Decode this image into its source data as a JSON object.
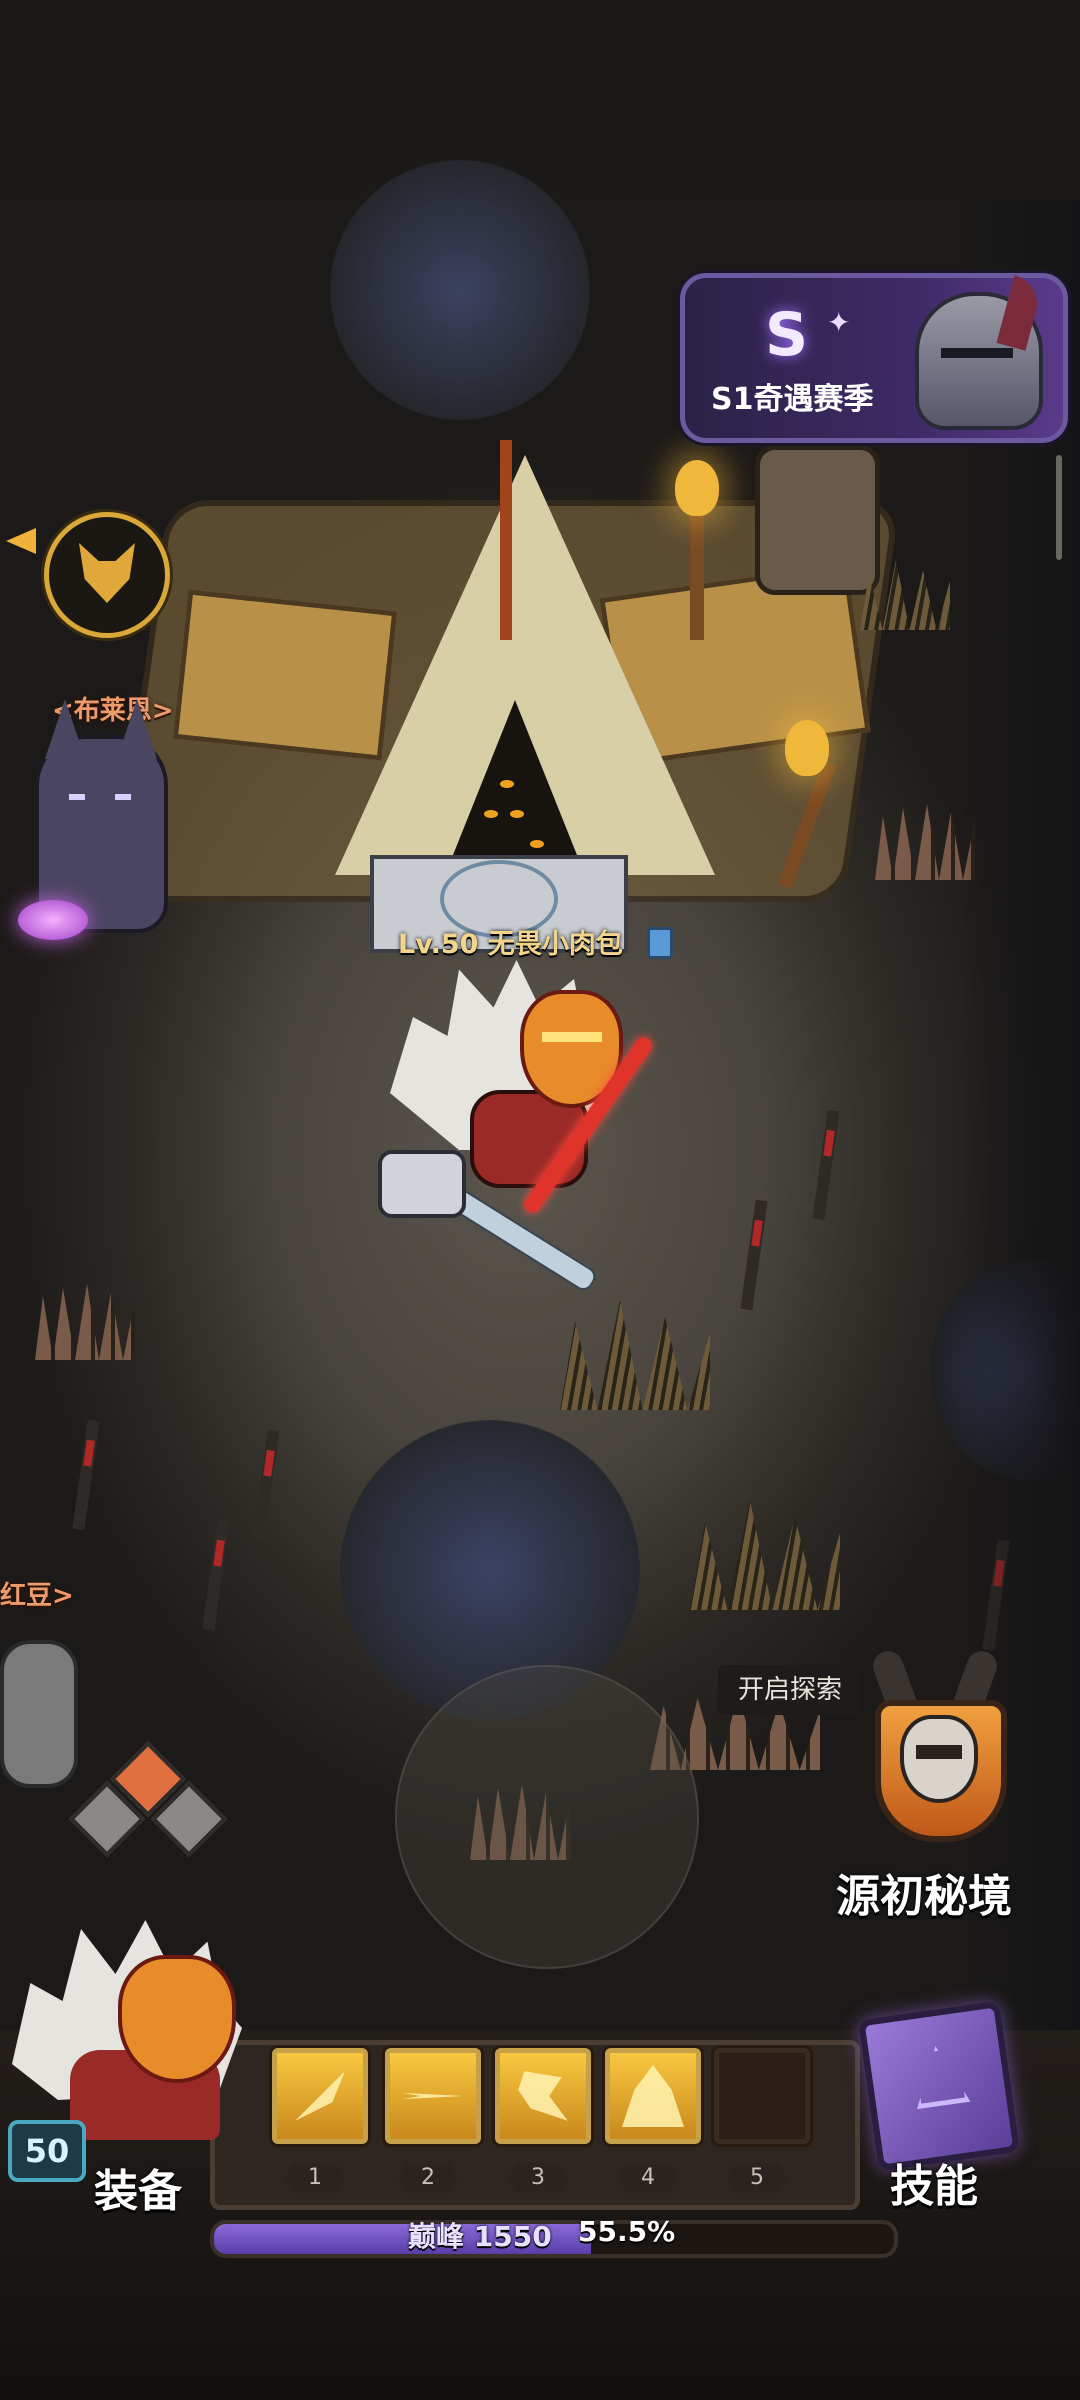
{
  "season": {
    "title": "S1奇遇赛季",
    "badge": "S"
  },
  "npcs": [
    {
      "name": "<布莱恩>"
    },
    {
      "name": "红豆>"
    }
  ],
  "player": {
    "name_tag": "Lv.50 无畏小肉包",
    "level": "50"
  },
  "explore": {
    "tooltip": "开启探索",
    "label": "源初秘境"
  },
  "bottom_bar": {
    "equip_label": "装备",
    "skill_label": "技能",
    "slots": [
      {
        "num": "1",
        "filled": true,
        "icon": "slash-arc-icon"
      },
      {
        "num": "2",
        "filled": true,
        "icon": "burst-strike-icon"
      },
      {
        "num": "3",
        "filled": true,
        "icon": "dragon-icon"
      },
      {
        "num": "4",
        "filled": true,
        "icon": "demon-icon"
      },
      {
        "num": "5",
        "filled": false,
        "icon": ""
      }
    ],
    "rank_text": "巅峰 1550",
    "progress_text": "55.5%",
    "progress": 0.555
  },
  "colors": {
    "accent_gold": "#c7a04a",
    "xp_purple": "#8a6ad8",
    "name_orange": "#ee9a6a"
  }
}
